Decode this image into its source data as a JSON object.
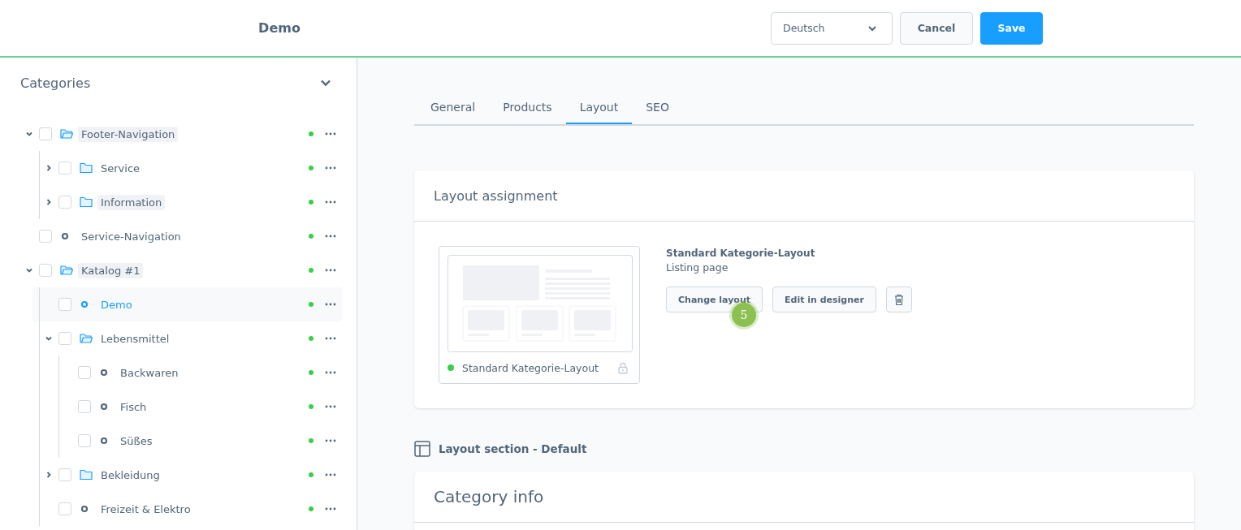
{
  "header": {
    "title": "Demo",
    "language": "Deutsch",
    "cancel": "Cancel",
    "save": "Save"
  },
  "sidebar": {
    "title": "Categories",
    "expanded": true,
    "tree": [
      {
        "label": "Footer-Navigation",
        "kind": "folder",
        "expanded": true,
        "highlighted": true,
        "selected": false,
        "checked": false,
        "children": [
          {
            "label": "Service",
            "kind": "folder",
            "expanded": false,
            "highlighted": false,
            "selected": false,
            "checked": false
          },
          {
            "label": "Information",
            "kind": "folder",
            "expanded": false,
            "highlighted": true,
            "selected": false,
            "checked": false
          }
        ]
      },
      {
        "label": "Service-Navigation",
        "kind": "leaf",
        "highlighted": false,
        "selected": false,
        "checked": false
      },
      {
        "label": "Katalog #1",
        "kind": "folder",
        "expanded": true,
        "highlighted": true,
        "selected": false,
        "checked": false,
        "children": [
          {
            "label": "Demo",
            "kind": "leaf",
            "highlighted": false,
            "selected": true,
            "checked": false
          },
          {
            "label": "Lebensmittel",
            "kind": "folder",
            "expanded": true,
            "highlighted": false,
            "selected": false,
            "checked": false,
            "children": [
              {
                "label": "Backwaren",
                "kind": "leaf",
                "highlighted": false,
                "selected": false,
                "checked": false
              },
              {
                "label": "Fisch",
                "kind": "leaf",
                "highlighted": false,
                "selected": false,
                "checked": false
              },
              {
                "label": "Süßes",
                "kind": "leaf",
                "highlighted": false,
                "selected": false,
                "checked": false
              }
            ]
          },
          {
            "label": "Bekleidung",
            "kind": "folder",
            "expanded": false,
            "highlighted": false,
            "selected": false,
            "checked": false
          },
          {
            "label": "Freizeit & Elektro",
            "kind": "leaf",
            "highlighted": false,
            "selected": false,
            "checked": false
          }
        ]
      }
    ]
  },
  "tabs": [
    {
      "label": "General",
      "selected": false
    },
    {
      "label": "Products",
      "selected": false
    },
    {
      "label": "Layout",
      "selected": true
    },
    {
      "label": "SEO",
      "selected": false
    }
  ],
  "layout_card": {
    "title": "Layout assignment",
    "preview_name": "Standard Kategorie-Layout",
    "layout_name": "Standard Kategorie-Layout",
    "layout_type": "Listing page",
    "change_button": "Change layout",
    "edit_button": "Edit in designer",
    "badge": "5"
  },
  "section": {
    "title": "Layout section - Default"
  },
  "info_card": {
    "title": "Category info"
  }
}
